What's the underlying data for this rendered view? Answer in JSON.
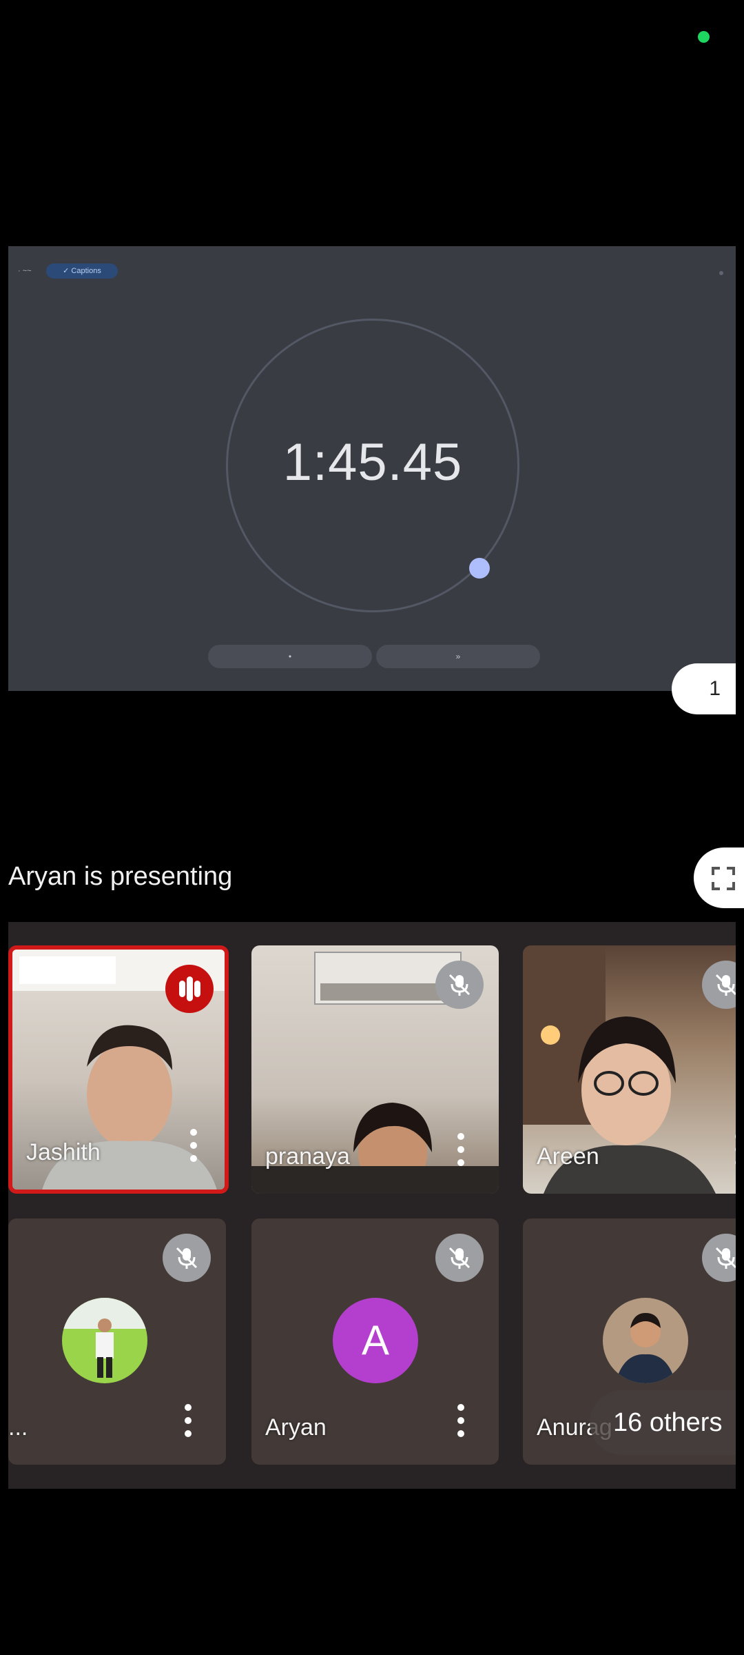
{
  "presentation": {
    "topbar_left": "· ~~",
    "topbar_chip": "✓ Captions",
    "timer": "1:45.45",
    "button_left_glyph": "•",
    "button_right_glyph": "»",
    "page_count": "1"
  },
  "presenting": {
    "label": "Aryan is presenting"
  },
  "participants": [
    {
      "name": "Jashith",
      "status": "speaking"
    },
    {
      "name": "pranaya",
      "status": "muted"
    },
    {
      "name": "Areen",
      "status": "muted"
    },
    {
      "name": "...",
      "status": "muted"
    },
    {
      "name": "Aryan",
      "status": "muted",
      "avatar_letter": "A"
    },
    {
      "name": "Anurag",
      "status": "muted"
    }
  ],
  "others": {
    "label": "16 others"
  },
  "colors": {
    "speaking_red": "#d11919",
    "avatar_purple": "#b43fcf",
    "status_green": "#1ed760"
  }
}
